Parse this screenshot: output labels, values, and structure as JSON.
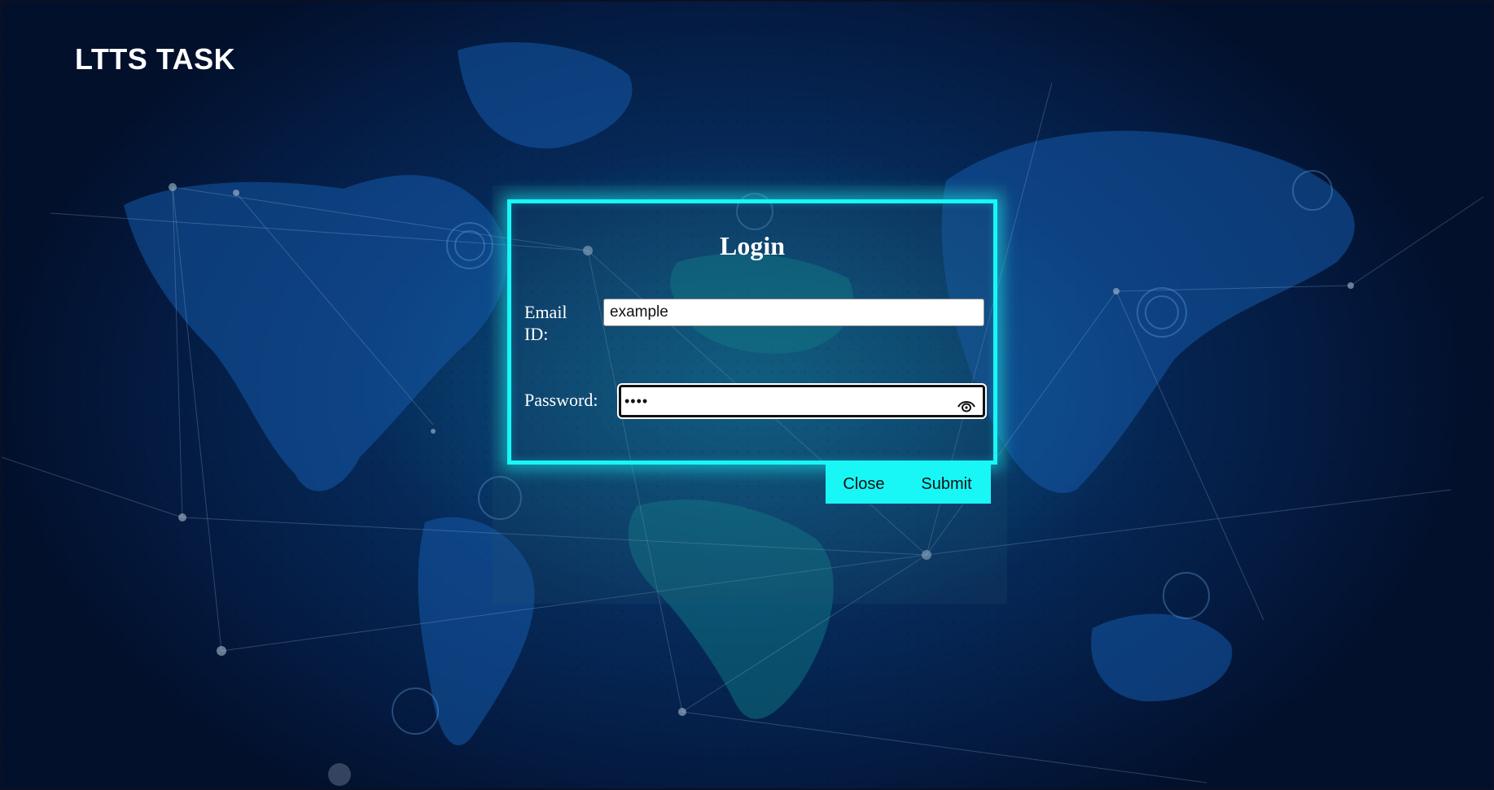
{
  "app": {
    "title": "LTTS TASK"
  },
  "login": {
    "title": "Login",
    "email_label": "Email ID:",
    "email_value": "example",
    "password_label": "Password:",
    "password_masked": "••••",
    "close_label": "Close",
    "submit_label": "Submit"
  },
  "icons": {
    "password_toggle": "eye-icon"
  },
  "colors": {
    "accent": "#19f6f6",
    "background": "#062b5c",
    "text": "#ffffff"
  }
}
